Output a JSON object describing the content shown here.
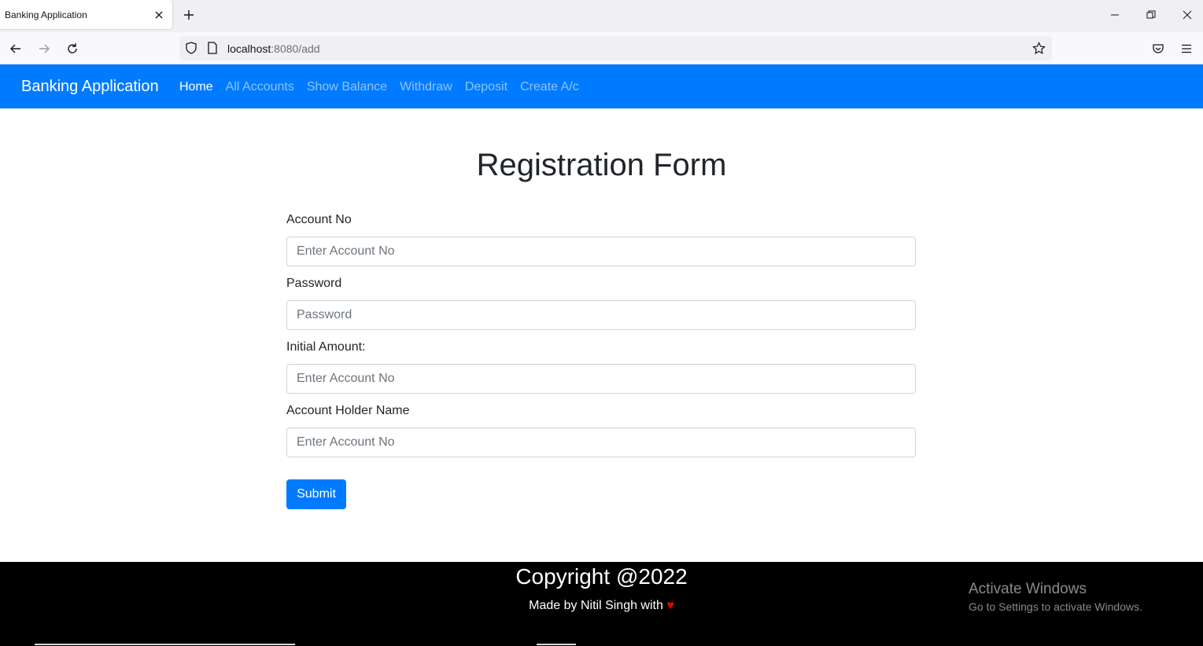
{
  "browser": {
    "tab_title": "Banking Application",
    "url_host": "localhost",
    "url_path": ":8080/add"
  },
  "navbar": {
    "brand": "Banking Application",
    "links": [
      "Home",
      "All Accounts",
      "Show Balance",
      "Withdraw",
      "Deposit",
      "Create A/c"
    ],
    "active": "Home",
    "color": "#007bff"
  },
  "form": {
    "title": "Registration Form",
    "fields": [
      {
        "label": "Account No",
        "placeholder": "Enter Account No"
      },
      {
        "label": "Password",
        "placeholder": "Password"
      },
      {
        "label": "Initial Amount:",
        "placeholder": "Enter Account No"
      },
      {
        "label": "Account Holder Name",
        "placeholder": "Enter Account No"
      }
    ],
    "submit_label": "Submit"
  },
  "footer": {
    "copyright": "Copyright @2022",
    "made_by": "Made by Nitil Singh with",
    "heart": "♥"
  },
  "os_overlay": {
    "line1": "Activate Windows",
    "line2": "Go to Settings to activate Windows."
  }
}
